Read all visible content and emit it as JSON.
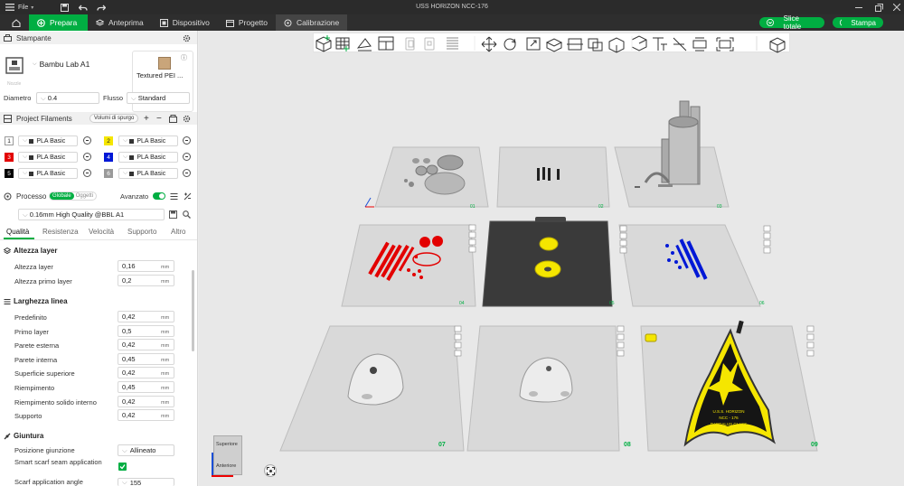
{
  "window": {
    "title": "USS HORIZON NCC-176",
    "menu_label": "File"
  },
  "tabs": [
    {
      "label": "Prepara"
    },
    {
      "label": "Anteprima"
    },
    {
      "label": "Dispositivo"
    },
    {
      "label": "Progetto"
    },
    {
      "label": "Calibrazione"
    }
  ],
  "actions": {
    "slice": "Slice totale",
    "print": "Stampa"
  },
  "printer": {
    "header": "Stampante",
    "name": "Bambu Lab A1",
    "plate": "Textured PEI ...",
    "nozzle_label": "Nozzle",
    "diameter_label": "Diametro",
    "diameter": "0.4",
    "flow_label": "Flusso",
    "flow": "Standard"
  },
  "filaments": {
    "header": "Project Filaments",
    "purge_button": "Volumi di spurgo",
    "items": [
      {
        "num": "1",
        "color": "#ffffff",
        "text": "#222222",
        "name": "PLA Basic"
      },
      {
        "num": "2",
        "color": "#f5e600",
        "text": "#222222",
        "name": "PLA Basic"
      },
      {
        "num": "3",
        "color": "#e30000",
        "text": "#ffffff",
        "name": "PLA Basic"
      },
      {
        "num": "4",
        "color": "#0018d6",
        "text": "#ffffff",
        "name": "PLA Basic"
      },
      {
        "num": "5",
        "color": "#000000",
        "text": "#ffffff",
        "name": "PLA Basic"
      },
      {
        "num": "6",
        "color": "#9a9a9a",
        "text": "#ffffff",
        "name": "PLA Basic"
      }
    ]
  },
  "process": {
    "header": "Processo",
    "toggle_global": "Globale",
    "toggle_objects": "Oggetti",
    "advanced_label": "Avanzato",
    "preset": "0.16mm High Quality @BBL A1",
    "tabs": [
      "Qualità",
      "Resistenza",
      "Velocità",
      "Supporto",
      "Altro"
    ]
  },
  "quality": {
    "layer_group": "Altezza layer",
    "layer_rows": [
      {
        "name": "Altezza layer",
        "value": "0,16",
        "unit": "mm"
      },
      {
        "name": "Altezza primo layer",
        "value": "0,2",
        "unit": "mm"
      }
    ],
    "width_group": "Larghezza linea",
    "width_rows": [
      {
        "name": "Predefinito",
        "value": "0,42",
        "unit": "mm"
      },
      {
        "name": "Primo layer",
        "value": "0,5",
        "unit": "mm"
      },
      {
        "name": "Parete esterna",
        "value": "0,42",
        "unit": "mm"
      },
      {
        "name": "Parete interna",
        "value": "0,45",
        "unit": "mm"
      },
      {
        "name": "Superficie superiore",
        "value": "0,42",
        "unit": "mm"
      },
      {
        "name": "Riempimento",
        "value": "0,45",
        "unit": "mm"
      },
      {
        "name": "Riempimento solido interno",
        "value": "0,42",
        "unit": "mm"
      },
      {
        "name": "Supporto",
        "value": "0,42",
        "unit": "mm"
      }
    ],
    "seam_group": "Giuntura",
    "seam_position_label": "Posizione giunzione",
    "seam_position": "Allineato",
    "scarf_label": "Smart scarf seam application",
    "scarf_angle_label": "Scarf application angle",
    "scarf_angle": "155"
  },
  "plates": [
    {
      "num": "01"
    },
    {
      "num": "02"
    },
    {
      "num": "03"
    },
    {
      "num": "04"
    },
    {
      "num": "05"
    },
    {
      "num": "06"
    },
    {
      "num": "07"
    },
    {
      "num": "08"
    },
    {
      "num": "09"
    }
  ],
  "viewcube": {
    "top": "Superiore",
    "front": "Anteriore"
  },
  "badge": {
    "line1": "U.S.S. HORIZON",
    "line2": "NCC - 176",
    "line3": "DAEDALUS CLASS"
  },
  "colors": {
    "accent": "#00ae42"
  }
}
